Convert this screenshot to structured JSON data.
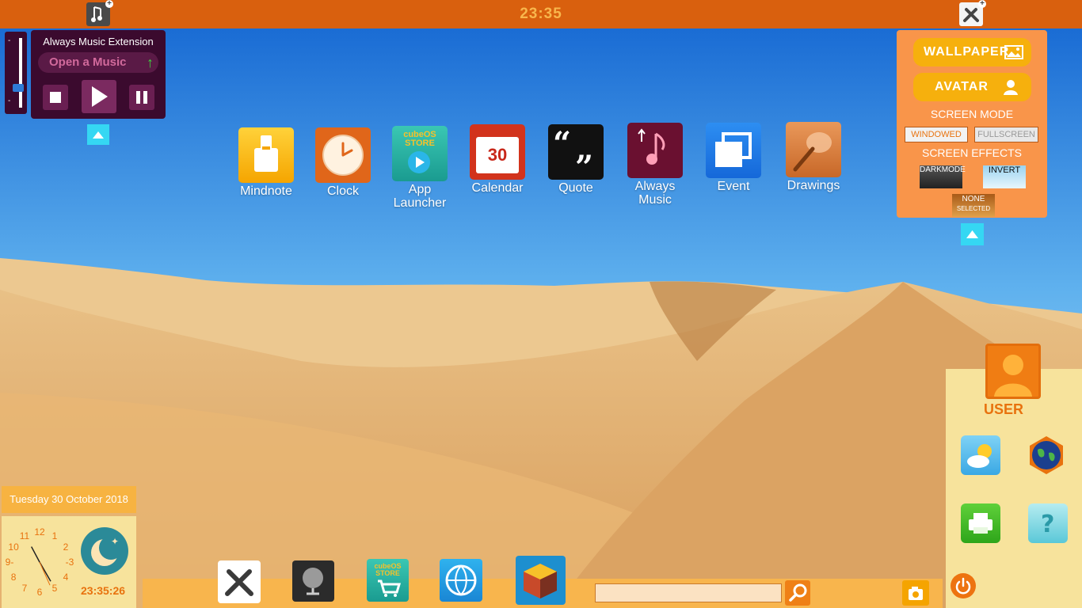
{
  "topbar": {
    "time": "23:35"
  },
  "music": {
    "title": "Always Music Extension",
    "open_label": "Open a Music",
    "volume_min": "-",
    "volume_max": "-"
  },
  "desktop_icons": [
    {
      "label": "Mindnote"
    },
    {
      "label": "Clock"
    },
    {
      "label": "App Launcher",
      "tile_text": "cubeOS STORE"
    },
    {
      "label": "Calendar",
      "tile_text": "30"
    },
    {
      "label": "Quote"
    },
    {
      "label": "Always Music"
    },
    {
      "label": "Event"
    },
    {
      "label": "Drawings"
    }
  ],
  "settings": {
    "wallpaper_label": "WALLPAPER",
    "avatar_label": "AVATAR",
    "screen_mode_heading": "SCREEN MODE",
    "windowed_label": "WINDOWED",
    "fullscreen_label": "FULLSCREEN",
    "screen_effects_heading": "SCREEN EFFECTS",
    "darkmode_label": "DARKMODE",
    "invert_label": "INVERT",
    "none_label": "NONE",
    "selected_label": "SELECTED"
  },
  "user": {
    "name": "USER"
  },
  "clock": {
    "date": "Tuesday 30 October 2018",
    "digital_time": "23:35:26",
    "numerals": [
      "12",
      "1",
      "2",
      "-3",
      "4",
      "5",
      "6",
      "7",
      "8",
      "9-",
      "10",
      "11"
    ]
  },
  "taskbar": {
    "store_tile_text": "cubeOS STORE",
    "search_value": ""
  },
  "colors": {
    "accent": "#d9600e",
    "panel": "#f9954a",
    "widget_bg": "#f7e39c",
    "music_bg": "#3b0a2e",
    "arrow_button": "#35d7f3"
  }
}
